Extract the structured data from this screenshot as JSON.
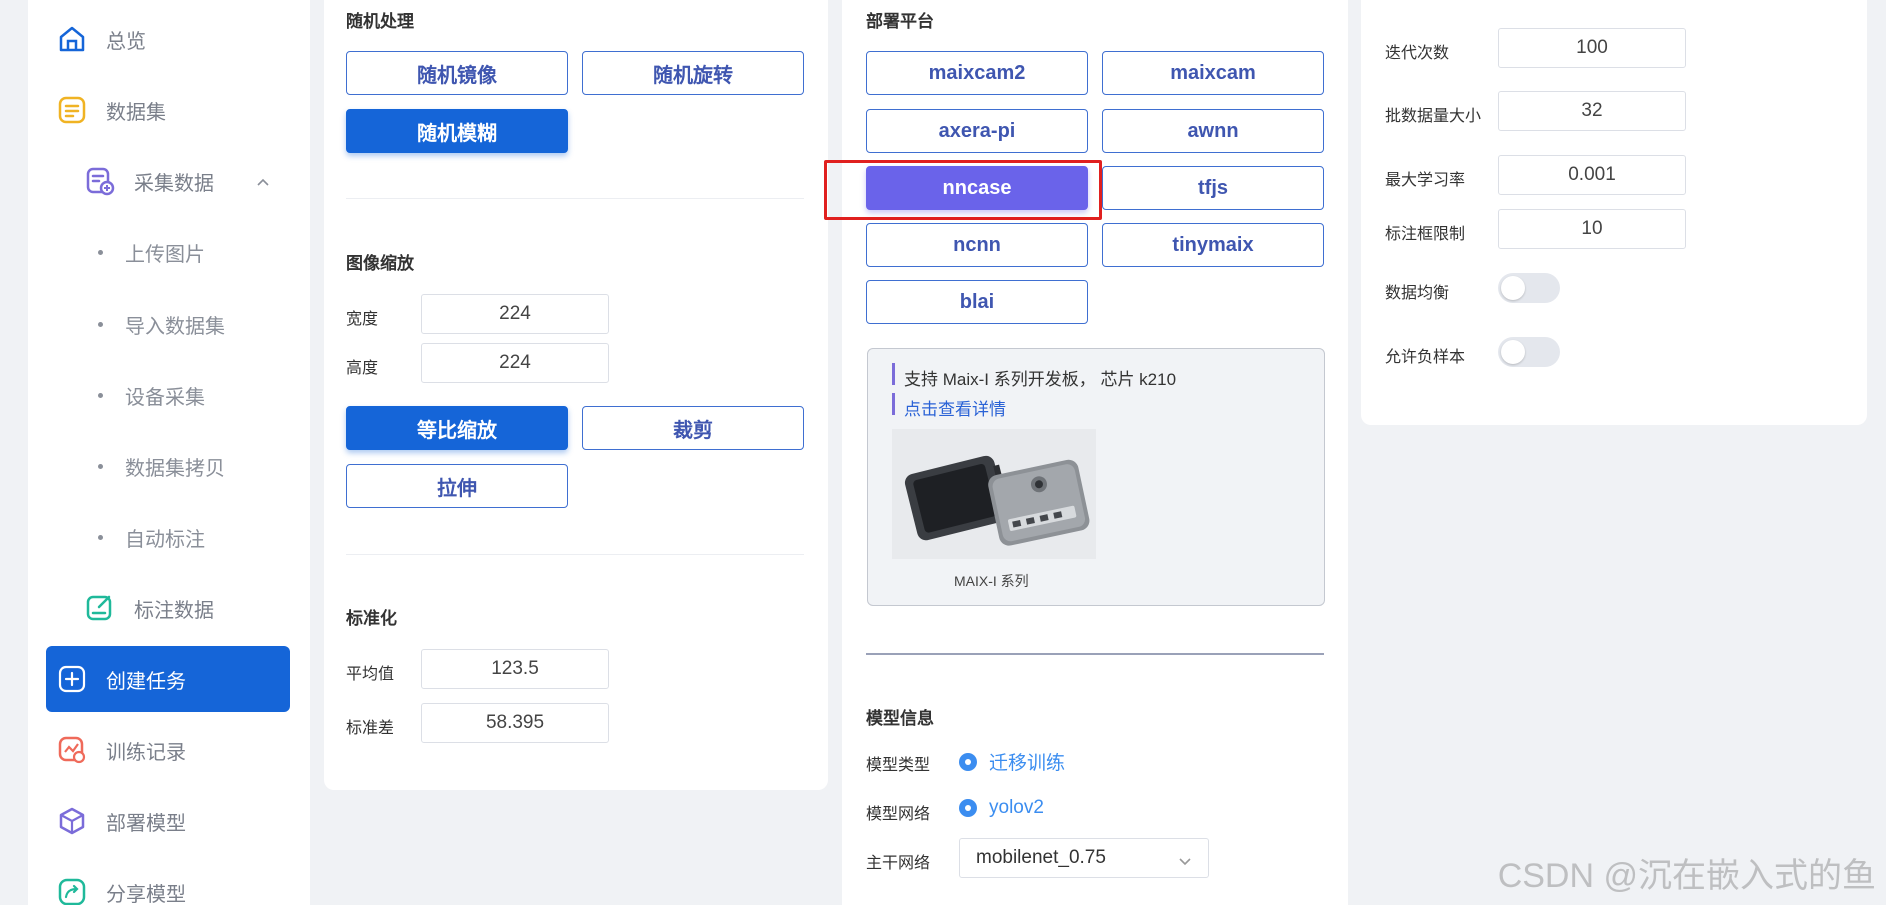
{
  "sidebar": {
    "overview": "总览",
    "dataset": "数据集",
    "collect": "采集数据",
    "upload_images": "上传图片",
    "import_dataset": "导入数据集",
    "device_collect": "设备采集",
    "dataset_copy": "数据集拷贝",
    "auto_label": "自动标注",
    "label_data": "标注数据",
    "create_task": "创建任务",
    "training_records": "训练记录",
    "deploy_model": "部署模型",
    "share_model": "分享模型"
  },
  "augment": {
    "title": "随机处理",
    "mirror": "随机镜像",
    "rotate": "随机旋转",
    "blur": "随机模糊"
  },
  "resize": {
    "title": "图像缩放",
    "width_label": "宽度",
    "width_value": "224",
    "height_label": "高度",
    "height_value": "224",
    "proportional": "等比缩放",
    "crop": "裁剪",
    "stretch": "拉伸"
  },
  "normalize": {
    "title": "标准化",
    "mean_label": "平均值",
    "mean_value": "123.5",
    "std_label": "标准差",
    "std_value": "58.395"
  },
  "deploy": {
    "title": "部署平台",
    "platforms": [
      "maixcam2",
      "maixcam",
      "axera-pi",
      "awnn",
      "nncase",
      "tfjs",
      "ncnn",
      "tinymaix",
      "blai"
    ],
    "selected": "nncase",
    "info_text": "支持 Maix-I 系列开发板， 芯片 k210",
    "info_link": "点击查看详情",
    "image_caption": "MAIX-I 系列"
  },
  "model": {
    "title": "模型信息",
    "type_label": "模型类型",
    "type_value": "迁移训练",
    "network_label": "模型网络",
    "network_value": "yolov2",
    "backbone_label": "主干网络",
    "backbone_value": "mobilenet_0.75"
  },
  "train": {
    "epochs_label": "迭代次数",
    "epochs_value": "100",
    "batch_label": "批数据量大小",
    "batch_value": "32",
    "lr_label": "最大学习率",
    "lr_value": "0.001",
    "box_limit_label": "标注框限制",
    "box_limit_value": "10",
    "balance_label": "数据均衡",
    "balance_on": false,
    "negative_label": "允许负样本",
    "negative_on": false
  },
  "watermark": "CSDN @沉在嵌入式的鱼",
  "colors": {
    "primary": "#1565d8",
    "selected": "#6a63ea",
    "highlight": "#e0201f",
    "link": "#2a62d6",
    "radio": "#3b8df0"
  }
}
